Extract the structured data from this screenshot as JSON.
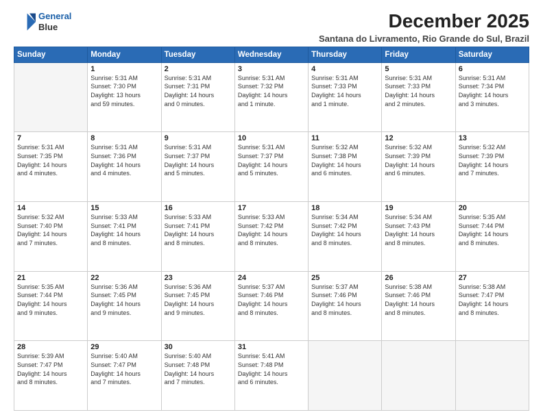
{
  "header": {
    "logo_line1": "General",
    "logo_line2": "Blue",
    "month": "December 2025",
    "location": "Santana do Livramento, Rio Grande do Sul, Brazil"
  },
  "days_of_week": [
    "Sunday",
    "Monday",
    "Tuesday",
    "Wednesday",
    "Thursday",
    "Friday",
    "Saturday"
  ],
  "weeks": [
    [
      {
        "day": "",
        "info": ""
      },
      {
        "day": "1",
        "info": "Sunrise: 5:31 AM\nSunset: 7:30 PM\nDaylight: 13 hours\nand 59 minutes."
      },
      {
        "day": "2",
        "info": "Sunrise: 5:31 AM\nSunset: 7:31 PM\nDaylight: 14 hours\nand 0 minutes."
      },
      {
        "day": "3",
        "info": "Sunrise: 5:31 AM\nSunset: 7:32 PM\nDaylight: 14 hours\nand 1 minute."
      },
      {
        "day": "4",
        "info": "Sunrise: 5:31 AM\nSunset: 7:33 PM\nDaylight: 14 hours\nand 1 minute."
      },
      {
        "day": "5",
        "info": "Sunrise: 5:31 AM\nSunset: 7:33 PM\nDaylight: 14 hours\nand 2 minutes."
      },
      {
        "day": "6",
        "info": "Sunrise: 5:31 AM\nSunset: 7:34 PM\nDaylight: 14 hours\nand 3 minutes."
      }
    ],
    [
      {
        "day": "7",
        "info": "Sunrise: 5:31 AM\nSunset: 7:35 PM\nDaylight: 14 hours\nand 4 minutes."
      },
      {
        "day": "8",
        "info": "Sunrise: 5:31 AM\nSunset: 7:36 PM\nDaylight: 14 hours\nand 4 minutes."
      },
      {
        "day": "9",
        "info": "Sunrise: 5:31 AM\nSunset: 7:37 PM\nDaylight: 14 hours\nand 5 minutes."
      },
      {
        "day": "10",
        "info": "Sunrise: 5:31 AM\nSunset: 7:37 PM\nDaylight: 14 hours\nand 5 minutes."
      },
      {
        "day": "11",
        "info": "Sunrise: 5:32 AM\nSunset: 7:38 PM\nDaylight: 14 hours\nand 6 minutes."
      },
      {
        "day": "12",
        "info": "Sunrise: 5:32 AM\nSunset: 7:39 PM\nDaylight: 14 hours\nand 6 minutes."
      },
      {
        "day": "13",
        "info": "Sunrise: 5:32 AM\nSunset: 7:39 PM\nDaylight: 14 hours\nand 7 minutes."
      }
    ],
    [
      {
        "day": "14",
        "info": "Sunrise: 5:32 AM\nSunset: 7:40 PM\nDaylight: 14 hours\nand 7 minutes."
      },
      {
        "day": "15",
        "info": "Sunrise: 5:33 AM\nSunset: 7:41 PM\nDaylight: 14 hours\nand 8 minutes."
      },
      {
        "day": "16",
        "info": "Sunrise: 5:33 AM\nSunset: 7:41 PM\nDaylight: 14 hours\nand 8 minutes."
      },
      {
        "day": "17",
        "info": "Sunrise: 5:33 AM\nSunset: 7:42 PM\nDaylight: 14 hours\nand 8 minutes."
      },
      {
        "day": "18",
        "info": "Sunrise: 5:34 AM\nSunset: 7:42 PM\nDaylight: 14 hours\nand 8 minutes."
      },
      {
        "day": "19",
        "info": "Sunrise: 5:34 AM\nSunset: 7:43 PM\nDaylight: 14 hours\nand 8 minutes."
      },
      {
        "day": "20",
        "info": "Sunrise: 5:35 AM\nSunset: 7:44 PM\nDaylight: 14 hours\nand 8 minutes."
      }
    ],
    [
      {
        "day": "21",
        "info": "Sunrise: 5:35 AM\nSunset: 7:44 PM\nDaylight: 14 hours\nand 9 minutes."
      },
      {
        "day": "22",
        "info": "Sunrise: 5:36 AM\nSunset: 7:45 PM\nDaylight: 14 hours\nand 9 minutes."
      },
      {
        "day": "23",
        "info": "Sunrise: 5:36 AM\nSunset: 7:45 PM\nDaylight: 14 hours\nand 9 minutes."
      },
      {
        "day": "24",
        "info": "Sunrise: 5:37 AM\nSunset: 7:46 PM\nDaylight: 14 hours\nand 8 minutes."
      },
      {
        "day": "25",
        "info": "Sunrise: 5:37 AM\nSunset: 7:46 PM\nDaylight: 14 hours\nand 8 minutes."
      },
      {
        "day": "26",
        "info": "Sunrise: 5:38 AM\nSunset: 7:46 PM\nDaylight: 14 hours\nand 8 minutes."
      },
      {
        "day": "27",
        "info": "Sunrise: 5:38 AM\nSunset: 7:47 PM\nDaylight: 14 hours\nand 8 minutes."
      }
    ],
    [
      {
        "day": "28",
        "info": "Sunrise: 5:39 AM\nSunset: 7:47 PM\nDaylight: 14 hours\nand 8 minutes."
      },
      {
        "day": "29",
        "info": "Sunrise: 5:40 AM\nSunset: 7:47 PM\nDaylight: 14 hours\nand 7 minutes."
      },
      {
        "day": "30",
        "info": "Sunrise: 5:40 AM\nSunset: 7:48 PM\nDaylight: 14 hours\nand 7 minutes."
      },
      {
        "day": "31",
        "info": "Sunrise: 5:41 AM\nSunset: 7:48 PM\nDaylight: 14 hours\nand 6 minutes."
      },
      {
        "day": "",
        "info": ""
      },
      {
        "day": "",
        "info": ""
      },
      {
        "day": "",
        "info": ""
      }
    ]
  ]
}
